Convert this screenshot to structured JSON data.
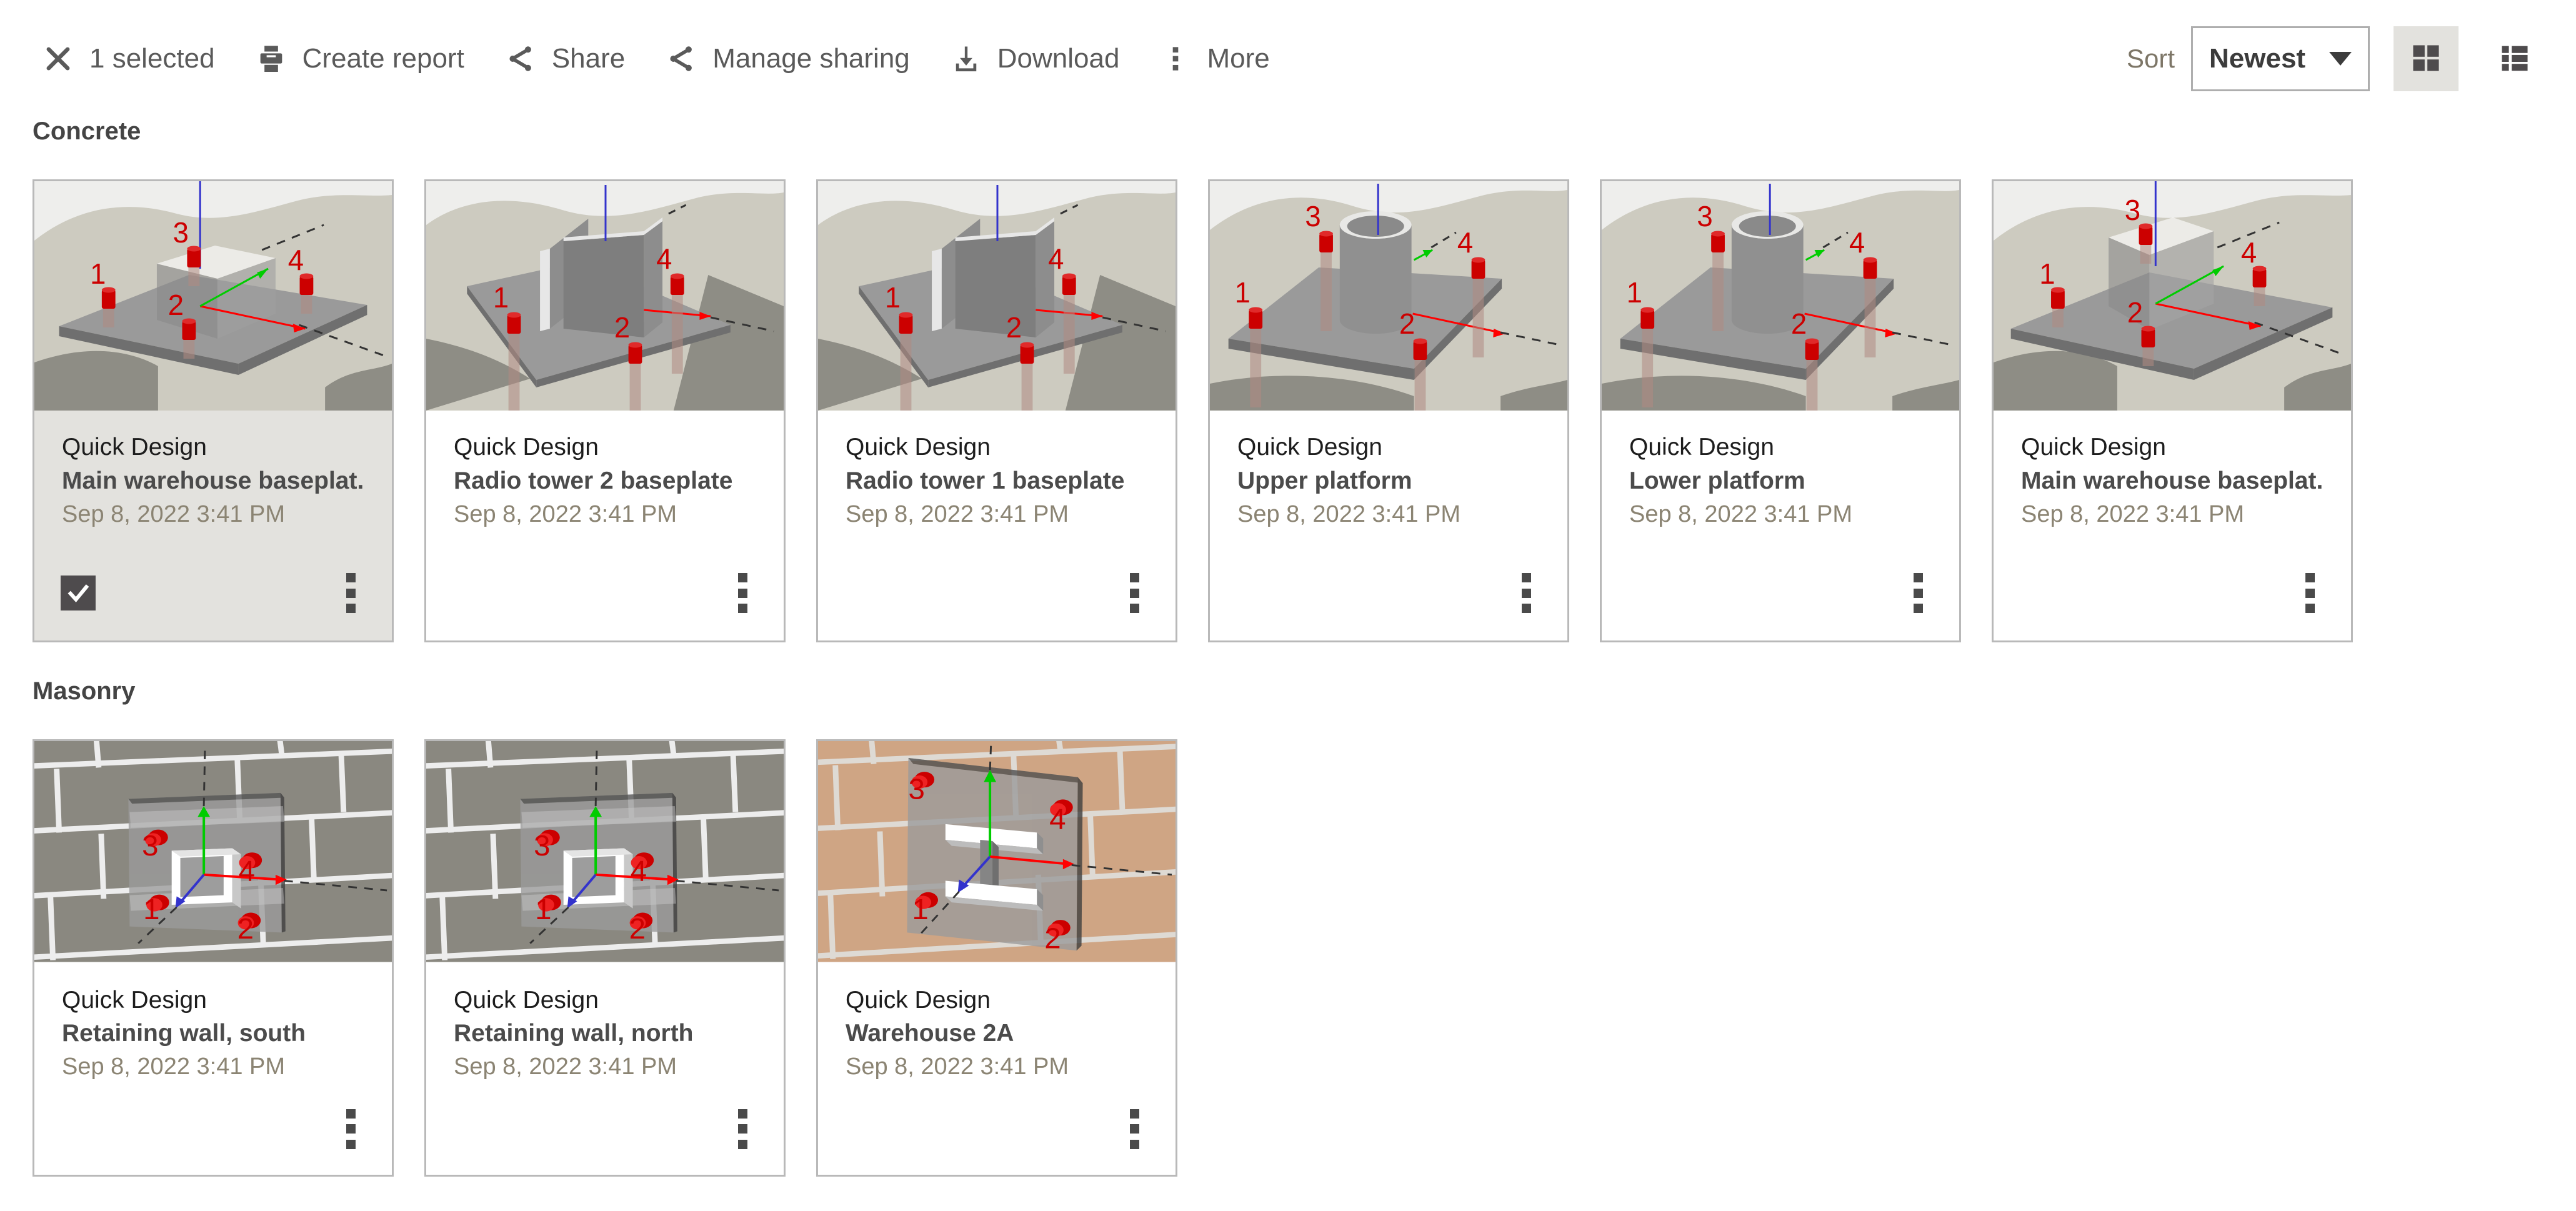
{
  "toolbar": {
    "close_icon": "close-icon",
    "selection_count_label": "1 selected",
    "actions": [
      {
        "icon": "print-icon",
        "label": "Create report"
      },
      {
        "icon": "share-icon",
        "label": "Share"
      },
      {
        "icon": "share-icon",
        "label": "Manage sharing"
      },
      {
        "icon": "download-icon",
        "label": "Download"
      },
      {
        "icon": "more-vertical-icon",
        "label": "More"
      }
    ],
    "sort_label": "Sort",
    "sort_value": "Newest",
    "sort_options": [
      "Newest"
    ],
    "grid_view_icon": "grid-view-icon",
    "list_view_icon": "list-view-icon",
    "active_view": "grid"
  },
  "colors": {
    "toolbar_text": "#5a5a5a",
    "selected_card_bg": "#e3e2de",
    "card_border": "#b9b9b9",
    "group_title": "#444444",
    "card_title": "#4b4b4b",
    "card_date": "#8b8473",
    "sort_label": "#7d7667",
    "accent_dark": "#4e4b4d",
    "anchor_red": "#cc0000",
    "axis_red": "#ff0000",
    "axis_green": "#00cc00",
    "axis_blue": "#3333cc",
    "brick_gray": "#8a8880",
    "brick_tan": "#cfa584"
  },
  "groups": [
    {
      "title": "Concrete",
      "cards": [
        {
          "kind": "Quick Design",
          "title": "Main warehouse baseplat...",
          "date": "Sep 8, 2022 3:41 PM",
          "selected": true,
          "checkbox_icon": "checkmark-icon",
          "menu_icon": "more-vertical-icon",
          "thumb": "concrete-box-short"
        },
        {
          "kind": "Quick Design",
          "title": "Radio tower 2 baseplate",
          "date": "Sep 8, 2022 3:41 PM",
          "selected": false,
          "checkbox_icon": "checkmark-icon",
          "menu_icon": "more-vertical-icon",
          "thumb": "concrete-walls"
        },
        {
          "kind": "Quick Design",
          "title": "Radio tower 1 baseplate",
          "date": "Sep 8, 2022 3:41 PM",
          "selected": false,
          "checkbox_icon": "checkmark-icon",
          "menu_icon": "more-vertical-icon",
          "thumb": "concrete-walls"
        },
        {
          "kind": "Quick Design",
          "title": "Upper platform",
          "date": "Sep 8, 2022 3:41 PM",
          "selected": false,
          "checkbox_icon": "checkmark-icon",
          "menu_icon": "more-vertical-icon",
          "thumb": "concrete-cylinder"
        },
        {
          "kind": "Quick Design",
          "title": "Lower platform",
          "date": "Sep 8, 2022 3:41 PM",
          "selected": false,
          "checkbox_icon": "checkmark-icon",
          "menu_icon": "more-vertical-icon",
          "thumb": "concrete-cylinder"
        },
        {
          "kind": "Quick Design",
          "title": "Main warehouse baseplat...",
          "date": "Sep 8, 2022 3:41 PM",
          "selected": false,
          "checkbox_icon": "checkmark-icon",
          "menu_icon": "more-vertical-icon",
          "thumb": "concrete-box-tall"
        }
      ]
    },
    {
      "title": "Masonry",
      "cards": [
        {
          "kind": "Quick Design",
          "title": "Retaining wall, south",
          "date": "Sep 8, 2022 3:41 PM",
          "selected": false,
          "checkbox_icon": "checkmark-icon",
          "menu_icon": "more-vertical-icon",
          "thumb": "masonry-gray-tube"
        },
        {
          "kind": "Quick Design",
          "title": "Retaining wall, north",
          "date": "Sep 8, 2022 3:41 PM",
          "selected": false,
          "checkbox_icon": "checkmark-icon",
          "menu_icon": "more-vertical-icon",
          "thumb": "masonry-gray-tube"
        },
        {
          "kind": "Quick Design",
          "title": "Warehouse 2A",
          "date": "Sep 8, 2022 3:41 PM",
          "selected": false,
          "checkbox_icon": "checkmark-icon",
          "menu_icon": "more-vertical-icon",
          "thumb": "masonry-tan-ibeam"
        }
      ]
    }
  ]
}
